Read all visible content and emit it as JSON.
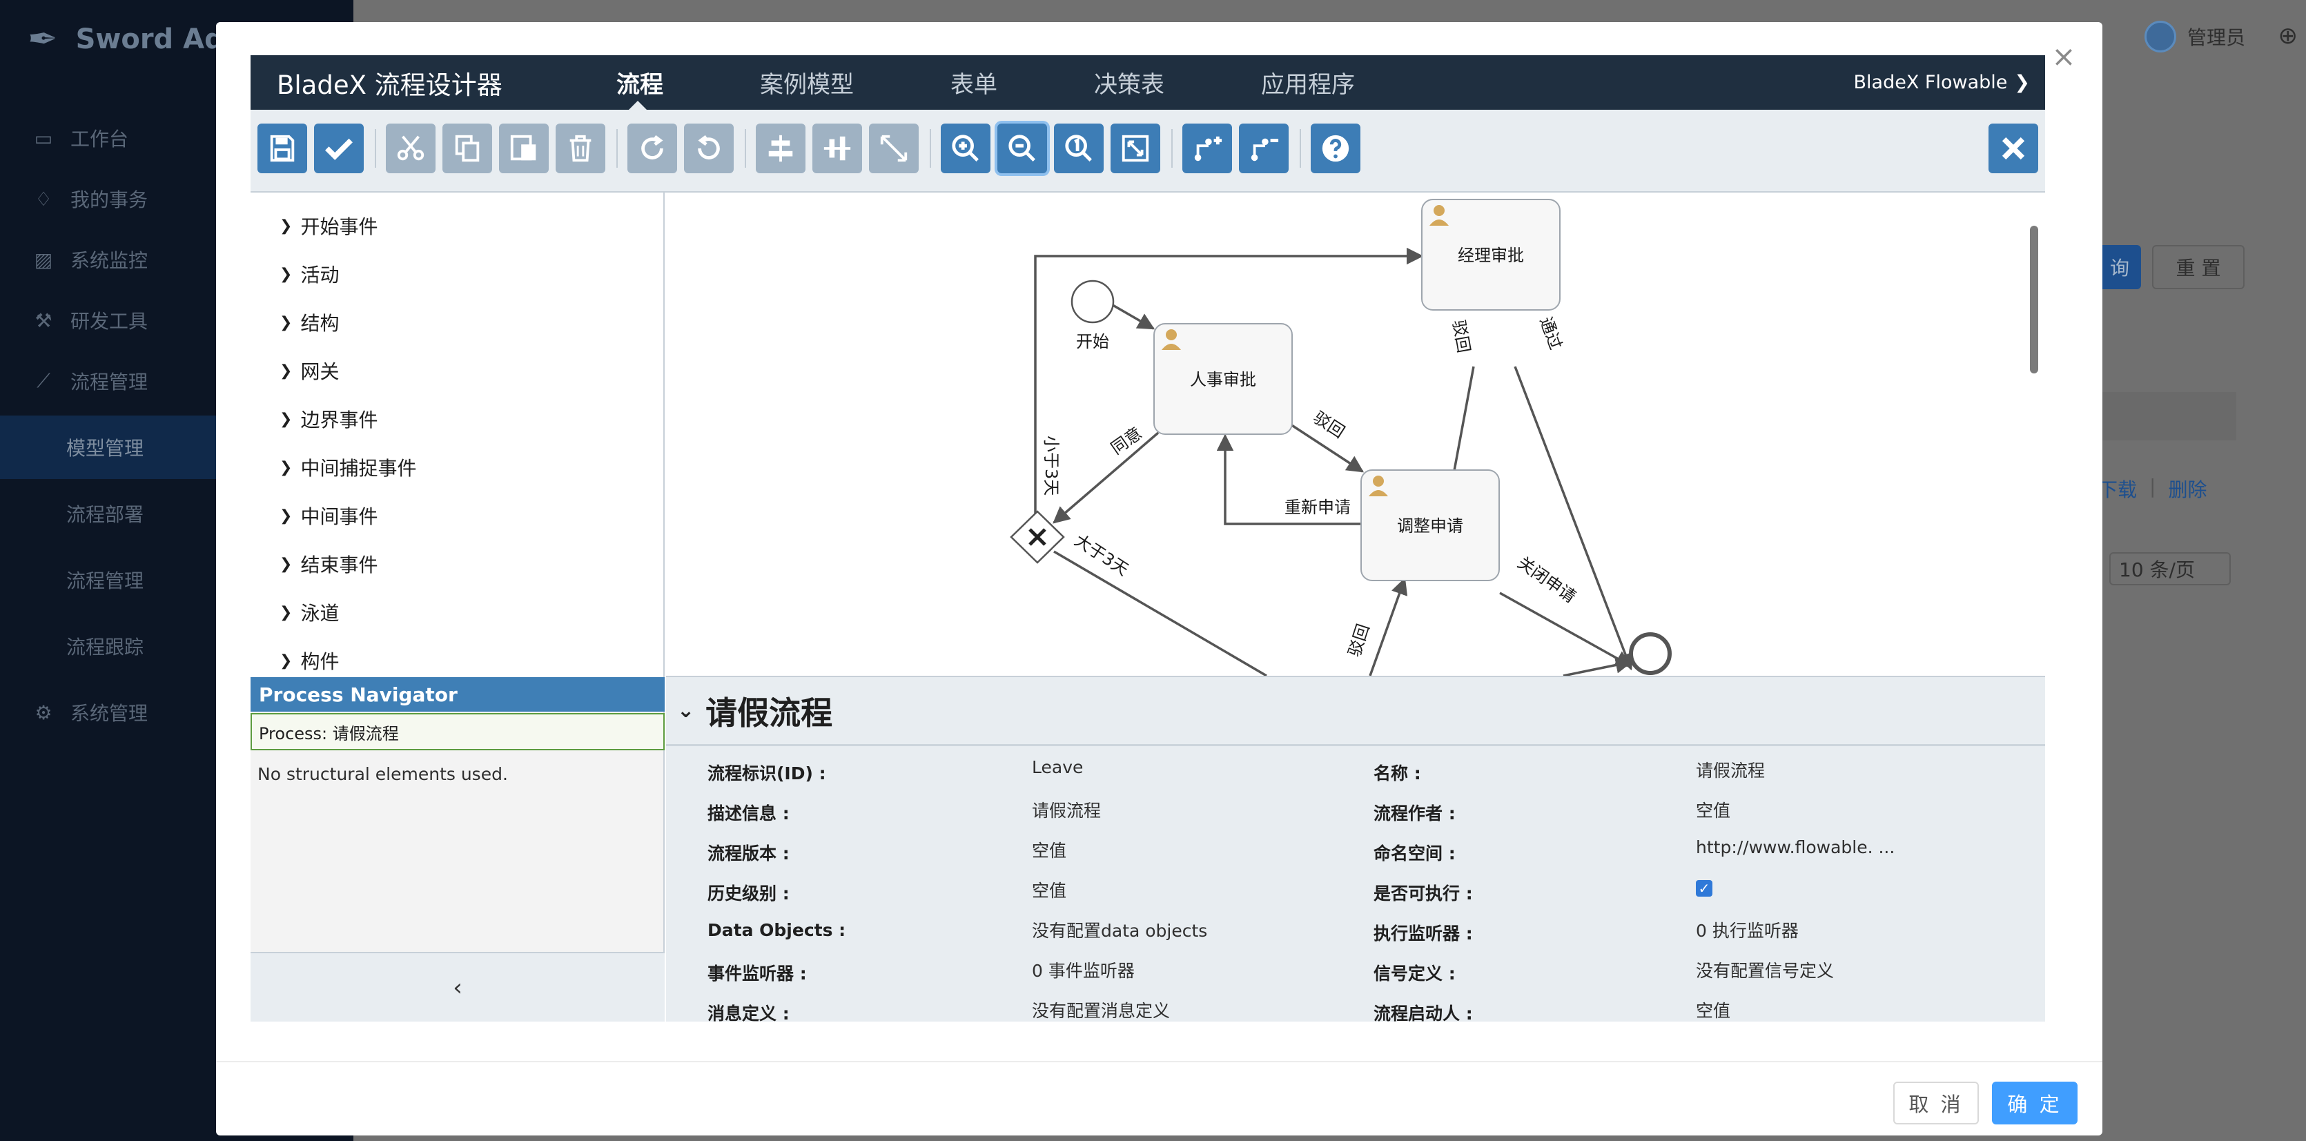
{
  "app": {
    "logo_text": "Sword Ad",
    "sidebar": [
      {
        "label": "工作台",
        "icon": "monitor-icon"
      },
      {
        "label": "我的事务",
        "icon": "bell-icon"
      },
      {
        "label": "系统监控",
        "icon": "chart-icon"
      },
      {
        "label": "研发工具",
        "icon": "wrench-icon"
      },
      {
        "label": "流程管理",
        "icon": "trend-icon"
      },
      {
        "label": "模型管理",
        "sub": true
      },
      {
        "label": "流程部署",
        "sub": true
      },
      {
        "label": "流程管理",
        "sub": true
      },
      {
        "label": "流程跟踪",
        "sub": true
      },
      {
        "label": "系统管理",
        "icon": "gear-icon"
      }
    ],
    "user": "管理员",
    "query_btn": "询",
    "reset_btn": "重 置",
    "row_actions": [
      "下载",
      "|",
      "删除"
    ],
    "page_size": "10 条/页"
  },
  "modal": {
    "cancel_label": "取 消",
    "ok_label": "确 定"
  },
  "designer": {
    "brand": "BladeX 流程设计器",
    "tabs": [
      "流程",
      "案例模型",
      "表单",
      "决策表",
      "应用程序"
    ],
    "active_tab": "流程",
    "tenant": "BladeX Flowable",
    "palette": [
      "开始事件",
      "活动",
      "结构",
      "网关",
      "边界事件",
      "中间捕捉事件",
      "中间事件",
      "结束事件",
      "泳道",
      "构件"
    ],
    "navigator_title": "Process Navigator",
    "navigator_process": "Process: 请假流程",
    "navigator_empty": "No structural elements used."
  },
  "diagram": {
    "start_label": "开始",
    "tasks": {
      "hr": "人事审批",
      "manager": "经理审批",
      "adjust": "调整申请"
    },
    "flow_labels": {
      "agree": "同意",
      "less3": "小于3天",
      "more3": "大于3天",
      "reject1": "驳回",
      "reapply": "重新申请",
      "reject2": "驳回",
      "pass": "通过",
      "close": "关闭申请",
      "reject3": "驳回"
    }
  },
  "properties": {
    "title": "请假流程",
    "rows": [
      {
        "l1": "流程标识(ID) :",
        "v1": "Leave",
        "l2": "名称 :",
        "v2": "请假流程"
      },
      {
        "l1": "描述信息 :",
        "v1": "请假流程",
        "l2": "流程作者 :",
        "v2": "空值"
      },
      {
        "l1": "流程版本 :",
        "v1": "空值",
        "l2": "命名空间 :",
        "v2": "http://www.flowable. ..."
      },
      {
        "l1": "历史级别 :",
        "v1": "空值",
        "l2": "是否可执行 :",
        "v2": "checked"
      },
      {
        "l1": "Data Objects :",
        "v1": "没有配置data objects",
        "l2": "执行监听器 :",
        "v2": "0 执行监听器"
      },
      {
        "l1": "事件监听器 :",
        "v1": "0 事件监听器",
        "l2": "信号定义 :",
        "v2": "没有配置信号定义"
      },
      {
        "l1": "消息定义 :",
        "v1": "没有配置消息定义",
        "l2": "流程启动人 :",
        "v2": "空值"
      }
    ]
  },
  "colors": {
    "nav_bg": "#1f2f40",
    "toolbar_bg": "#e8edf1",
    "primary_btn": "#3d7db6",
    "disabled_btn": "#9fb2c3",
    "ok_btn": "#409eff"
  }
}
